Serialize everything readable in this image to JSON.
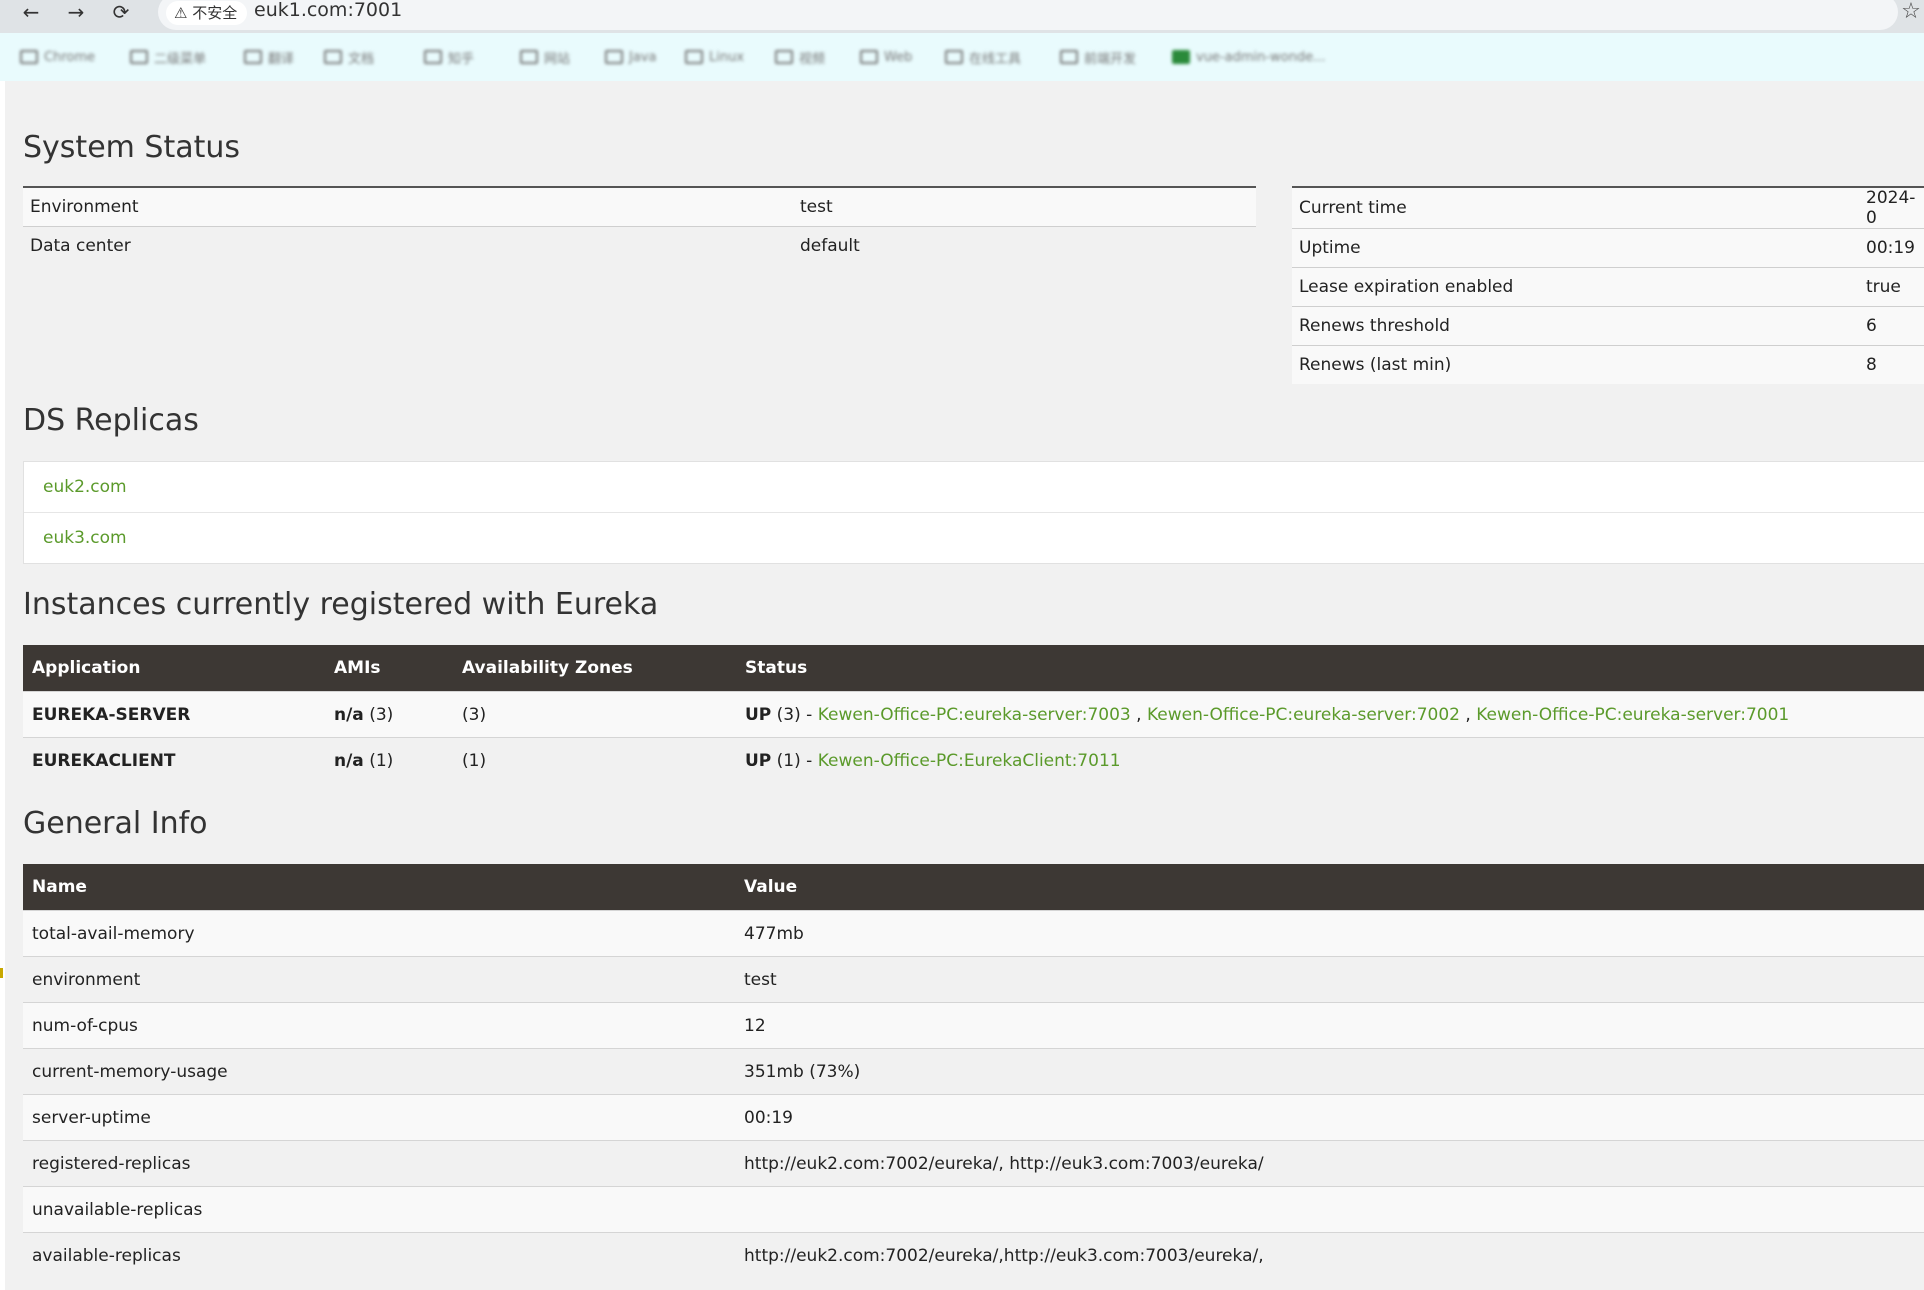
{
  "browser": {
    "back_icon": "←",
    "forward_icon": "→",
    "reload_icon": "⟳",
    "security_label": "⚠ 不安全",
    "url": "euk1.com:7001",
    "star_icon": "☆",
    "bookmarks": [
      "Chrome",
      "二级菜单",
      "翻译",
      "文档",
      "知乎",
      "网站",
      "Java",
      "Linux",
      "视频",
      "Web",
      "在线工具",
      "前端开发",
      "vue-admin-wonde..."
    ]
  },
  "system_status": {
    "title": "System Status",
    "left": [
      {
        "key": "Environment",
        "value": "test"
      },
      {
        "key": "Data center",
        "value": "default"
      }
    ],
    "right": [
      {
        "key": "Current time",
        "value": "2024-0"
      },
      {
        "key": "Uptime",
        "value": "00:19"
      },
      {
        "key": "Lease expiration enabled",
        "value": "true"
      },
      {
        "key": "Renews threshold",
        "value": "6"
      },
      {
        "key": "Renews (last min)",
        "value": "8"
      }
    ]
  },
  "ds_replicas": {
    "title": "DS Replicas",
    "items": [
      "euk2.com",
      "euk3.com"
    ]
  },
  "instances": {
    "title": "Instances currently registered with Eureka",
    "headers": [
      "Application",
      "AMIs",
      "Availability Zones",
      "Status"
    ],
    "rows": [
      {
        "application": "EUREKA-SERVER",
        "amis_label": "n/a",
        "amis_count": "(3)",
        "zones": "(3)",
        "status": "UP",
        "status_count": "(3) -",
        "links": [
          "Kewen-Office-PC:eureka-server:7003",
          "Kewen-Office-PC:eureka-server:7002",
          "Kewen-Office-PC:eureka-server:7001"
        ]
      },
      {
        "application": "EUREKACLIENT",
        "amis_label": "n/a",
        "amis_count": "(1)",
        "zones": "(1)",
        "status": "UP",
        "status_count": "(1) -",
        "links": [
          "Kewen-Office-PC:EurekaClient:7011"
        ]
      }
    ]
  },
  "general_info": {
    "title": "General Info",
    "headers": [
      "Name",
      "Value"
    ],
    "rows": [
      {
        "name": "total-avail-memory",
        "value": "477mb"
      },
      {
        "name": "environment",
        "value": "test"
      },
      {
        "name": "num-of-cpus",
        "value": "12"
      },
      {
        "name": "current-memory-usage",
        "value": "351mb (73%)"
      },
      {
        "name": "server-uptime",
        "value": "00:19"
      },
      {
        "name": "registered-replicas",
        "value": "http://euk2.com:7002/eureka/, http://euk3.com:7003/eureka/"
      },
      {
        "name": "unavailable-replicas",
        "value": ""
      },
      {
        "name": "available-replicas",
        "value": "http://euk2.com:7002/eureka/,http://euk3.com:7003/eureka/,"
      }
    ]
  }
}
